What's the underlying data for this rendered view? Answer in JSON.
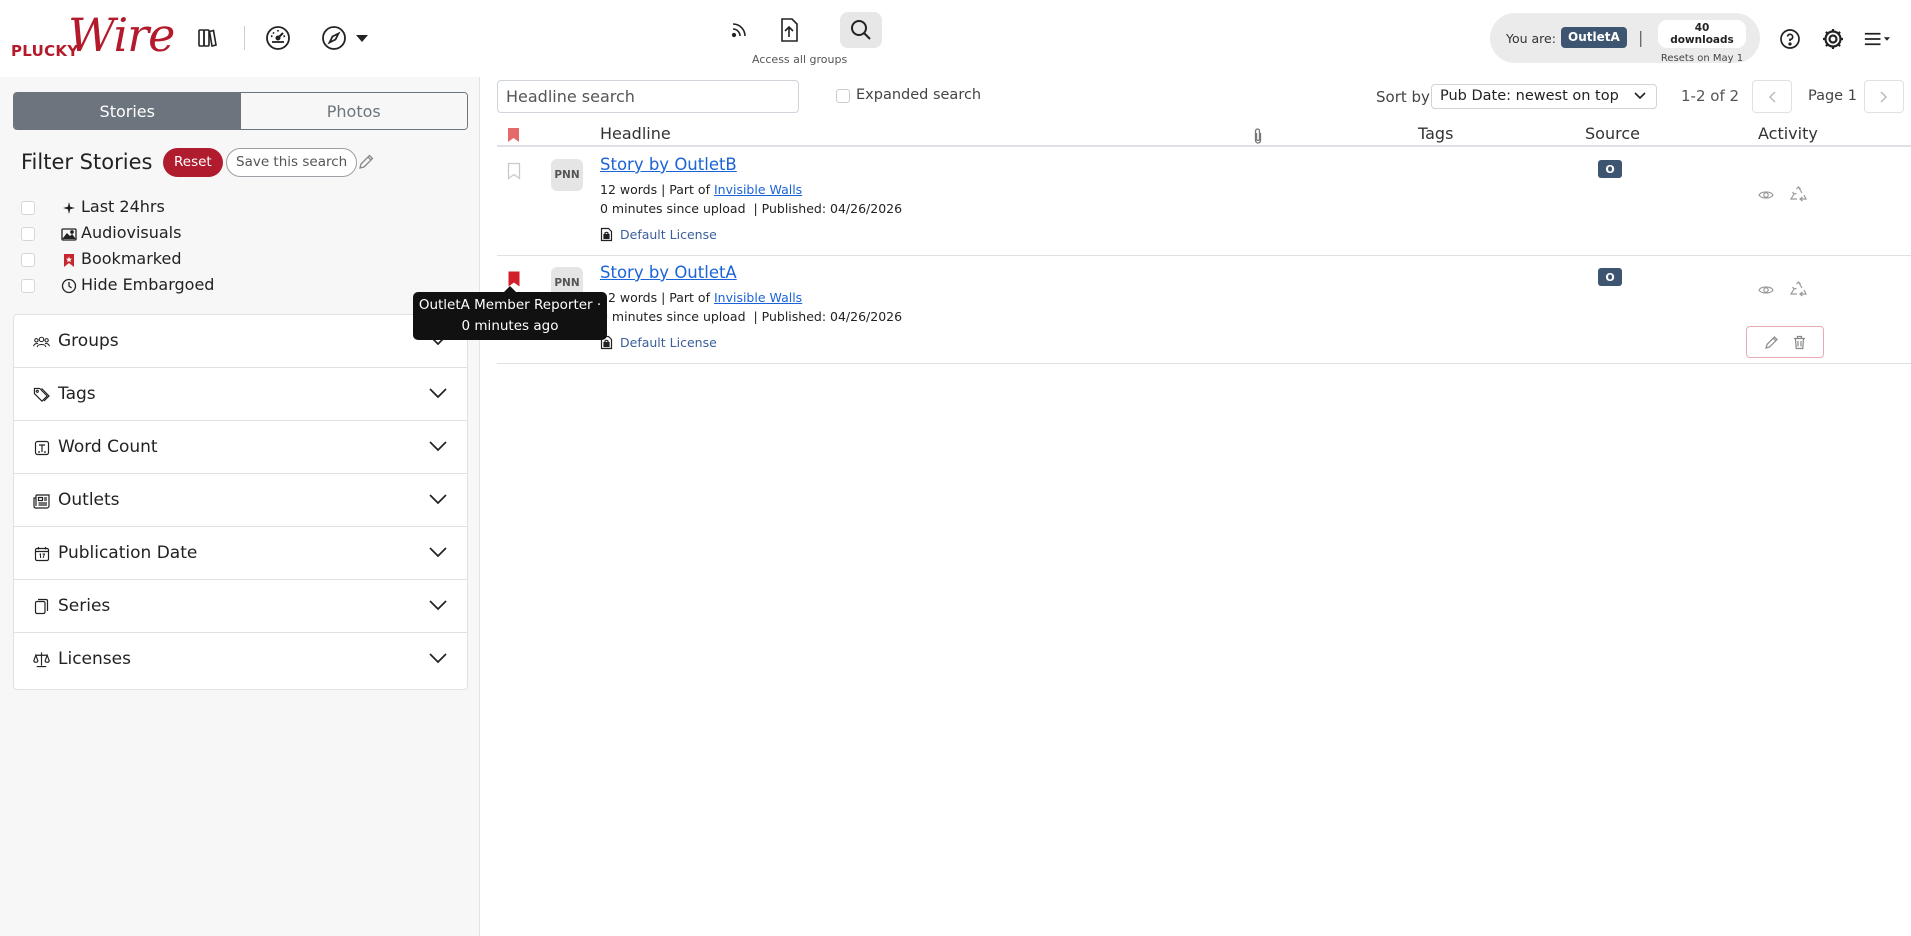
{
  "app": {
    "logo_small": "PLUCKY",
    "logo_big": "Wire",
    "access_label": "Access all groups",
    "you_are_label": "You are:",
    "outlet": "OutletA",
    "downloads": "40 downloads",
    "downloads_reset": "Resets on May 1",
    "brand_color": "#b31b2c",
    "badge_color": "#3e5571"
  },
  "sidebar": {
    "tabs": [
      {
        "label": "Stories",
        "active": true
      },
      {
        "label": "Photos",
        "active": false
      }
    ],
    "filter_title": "Filter Stories",
    "reset_label": "Reset",
    "save_label": "Save this search",
    "quick_filters": [
      {
        "label": "Last 24hrs",
        "icon": "sparkle-icon"
      },
      {
        "label": "Audiovisuals",
        "icon": "image-icon"
      },
      {
        "label": "Bookmarked",
        "icon": "bookmark-icon"
      },
      {
        "label": "Hide Embargoed",
        "icon": "clock-icon"
      }
    ],
    "sections": [
      {
        "label": "Groups",
        "icon": "people-icon"
      },
      {
        "label": "Tags",
        "icon": "tags-icon"
      },
      {
        "label": "Word Count",
        "icon": "wordcount-icon"
      },
      {
        "label": "Outlets",
        "icon": "newspaper-icon"
      },
      {
        "label": "Publication Date",
        "icon": "calendar-icon"
      },
      {
        "label": "Series",
        "icon": "files-icon"
      },
      {
        "label": "Licenses",
        "icon": "scales-icon"
      }
    ]
  },
  "search": {
    "placeholder": "Headline search",
    "expanded_label": "Expanded search",
    "sort_label": "Sort by",
    "sort_value": "Pub Date: newest on top",
    "count": "1-2 of 2",
    "page": "Page 1"
  },
  "table": {
    "headers": {
      "headline": "Headline",
      "tags": "Tags",
      "source": "Source",
      "activity": "Activity"
    },
    "rows": [
      {
        "bookmarked": false,
        "avatar": "PNN",
        "headline": "Story by OutletB",
        "words": "12 words | Part of",
        "series": "Invisible Walls",
        "uploaded": "0 minutes since upload",
        "published": "| Published: 04/26/2026",
        "license": "Default License",
        "source_badge": "O"
      },
      {
        "bookmarked": true,
        "avatar": "PNN",
        "headline": "Story by OutletA",
        "words": "12 words | Part of",
        "series": "Invisible Walls",
        "uploaded": "0 minutes since upload",
        "published": "| Published: 04/26/2026",
        "license": "Default License",
        "source_badge": "O"
      }
    ]
  },
  "tooltip": {
    "line1": "OutletA Member Reporter ·",
    "line2": "0 minutes ago"
  }
}
